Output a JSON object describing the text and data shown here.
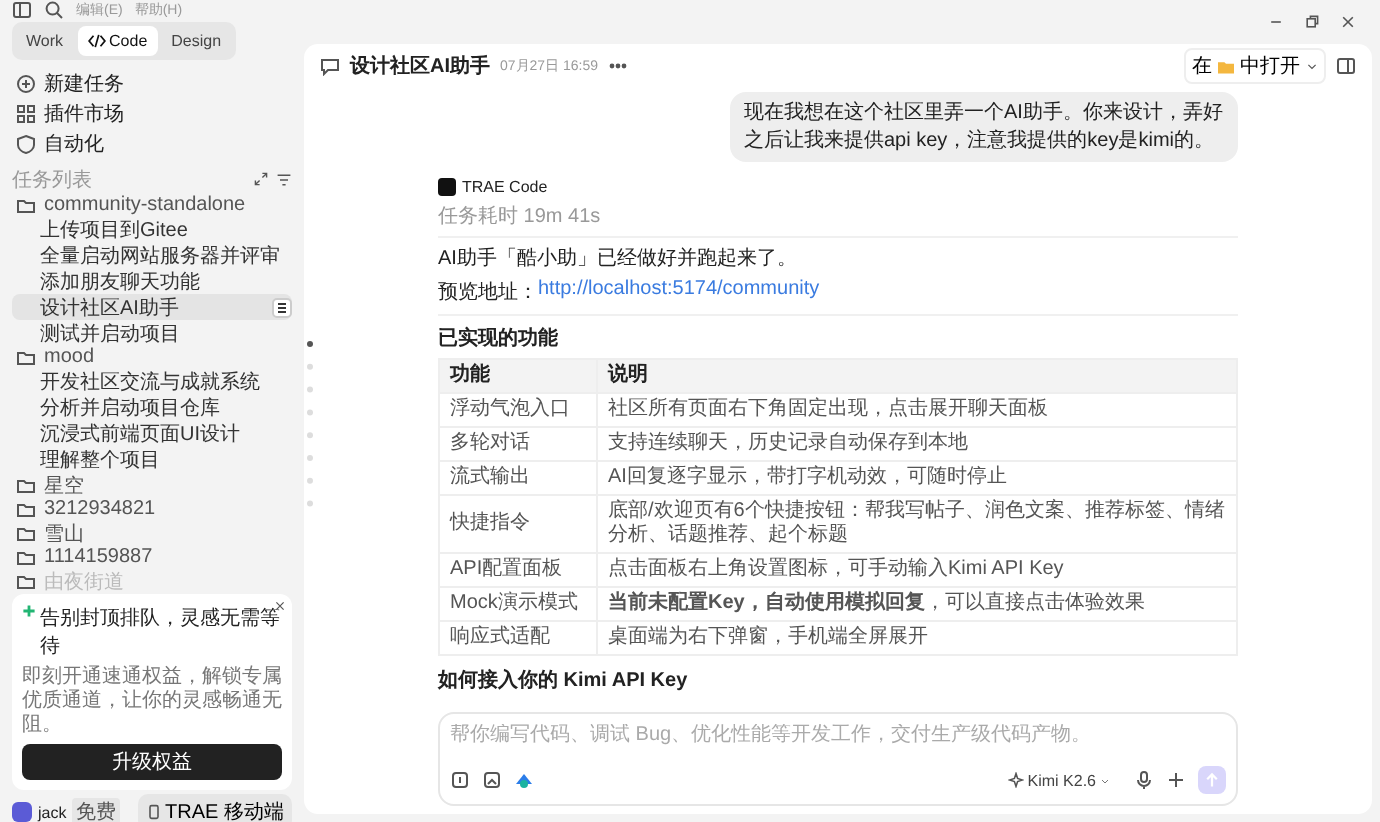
{
  "menu": [
    "编辑(E)",
    "帮助(H)"
  ],
  "mode_tabs": [
    {
      "label": "Work",
      "selected": false,
      "kind": "text"
    },
    {
      "label": "Code",
      "selected": true,
      "kind": "code"
    },
    {
      "label": "Design",
      "selected": false,
      "kind": "text"
    }
  ],
  "nav": [
    {
      "label": "新建任务",
      "kind": "new"
    },
    {
      "label": "插件市场",
      "kind": "plugins"
    },
    {
      "label": "自动化",
      "kind": "auto"
    }
  ],
  "task_list": {
    "title": "任务列表",
    "folders": [
      {
        "name": "community-standalone",
        "faded": false,
        "children": [
          {
            "label": "上传项目到Gitee",
            "selected": false
          },
          {
            "label": "全量启动网站服务器并评审",
            "selected": false
          },
          {
            "label": "添加朋友聊天功能",
            "selected": false
          },
          {
            "label": "设计社区AI助手",
            "selected": true
          },
          {
            "label": "测试并启动项目",
            "selected": false
          }
        ]
      },
      {
        "name": "mood",
        "faded": false,
        "children": [
          {
            "label": "开发社区交流与成就系统",
            "selected": false
          },
          {
            "label": "分析并启动项目仓库",
            "selected": false
          },
          {
            "label": "沉浸式前端页面UI设计",
            "selected": false
          },
          {
            "label": "理解整个项目",
            "selected": false
          }
        ]
      },
      {
        "name": "星空",
        "faded": false
      },
      {
        "name": "3212934821",
        "faded": false
      },
      {
        "name": "雪山",
        "faded": false
      },
      {
        "name": "1114159887",
        "faded": false
      },
      {
        "name": "由夜街道",
        "faded": true
      }
    ]
  },
  "promo": {
    "title": "告别封顶排队，灵感无需等待",
    "body": "即刻开通速通权益，解锁专属优质通道，让你的灵感畅通无阻。",
    "button": "升级权益"
  },
  "user": {
    "name": "jack",
    "plan": "免费"
  },
  "mobile_button": "TRAE 移动端",
  "chat": {
    "title": "设计社区AI助手",
    "time": "07月27日 16:59",
    "open_in": {
      "prefix": "在",
      "label": "中打开"
    }
  },
  "user_message": "现在我想在这个社区里弄一个AI助手。你来设计，弄好之后让我来提供api key，注意我提供的key是kimi的。",
  "response": {
    "agent": "TRAE Code",
    "duration": "任务耗时 19m 41s",
    "summary": "AI助手「酷小助」已经做好并跑起来了。",
    "preview_label": "预览地址：",
    "preview_link": "http://localhost:5174/community",
    "heading": "已实现的功能",
    "table": {
      "columns": [
        "功能",
        "说明"
      ],
      "rows": [
        [
          "浮动气泡入口",
          "社区所有页面右下角固定出现，点击展开聊天面板"
        ],
        [
          "多轮对话",
          "支持连续聊天，历史记录自动保存到本地"
        ],
        [
          "流式输出",
          "AI回复逐字显示，带打字机动效，可随时停止"
        ],
        [
          "快捷指令",
          "底部/欢迎页有6个快捷按钮：帮我写帖子、润色文案、推荐标签、情绪分析、话题推荐、起个标题"
        ],
        [
          "API配置面板",
          "点击面板右上角设置图标，可手动输入Kimi API Key"
        ],
        [
          "Mock演示模式",
          "**当前未配置Key，自动使用模拟回复**，可以直接点击体验效果"
        ],
        [
          "响应式适配",
          "桌面端为右下弹窗，手机端全屏展开"
        ]
      ]
    },
    "heading2": "如何接入你的 Kimi API Key"
  },
  "composer": {
    "placeholder": "帮你编写代码、调试 Bug、优化性能等开发工作，交付生产级代码产物。",
    "model": "Kimi K2.6"
  }
}
